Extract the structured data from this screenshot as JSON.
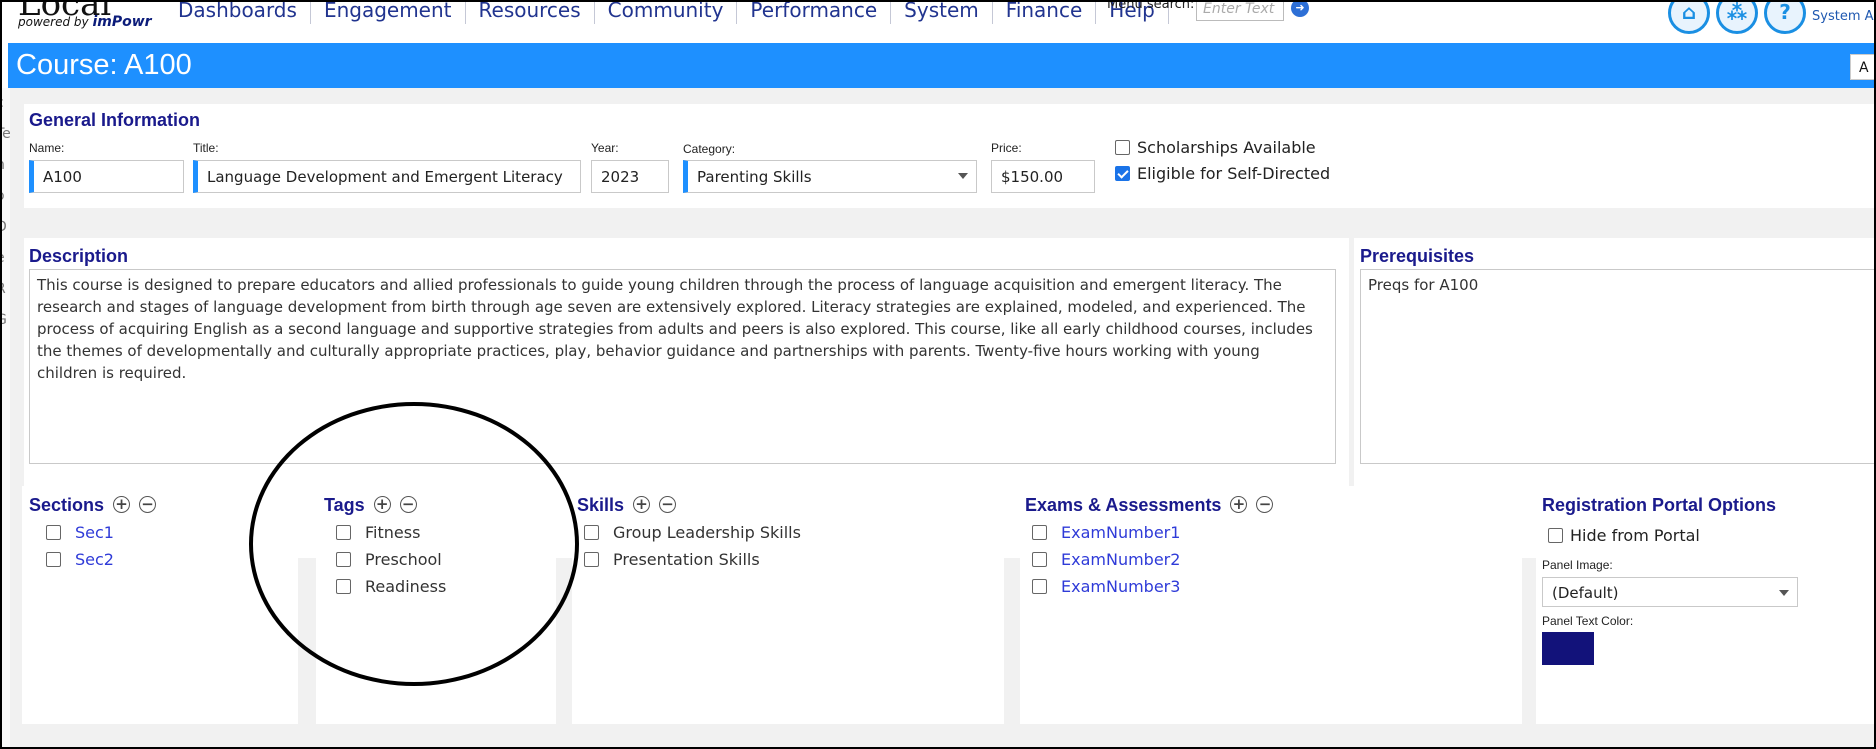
{
  "nav": {
    "logo_text": "Local",
    "logo_powered": "powered by",
    "logo_brand": "imPowr",
    "menu": [
      "Dashboards",
      "Engagement",
      "Resources",
      "Community",
      "Performance",
      "System",
      "Finance",
      "Help"
    ],
    "menu_search_label": "Menu search:",
    "menu_search_placeholder": "Enter Text",
    "user_label": "System Admin"
  },
  "page": {
    "title": "Course: A100",
    "corner_button": "A"
  },
  "general": {
    "title": "General Information",
    "name_label": "Name:",
    "name_value": "A100",
    "title_label": "Title:",
    "title_value": "Language Development and Emergent Literacy",
    "year_label": "Year:",
    "year_value": "2023",
    "category_label": "Category:",
    "category_value": "Parenting Skills",
    "price_label": "Price:",
    "price_value": "$150.00",
    "scholarships_label": "Scholarships Available",
    "scholarships_checked": false,
    "self_directed_label": "Eligible for Self-Directed",
    "self_directed_checked": true
  },
  "description": {
    "title": "Description",
    "lines": [
      "This course is designed to prepare educators and allied professionals to guide young children through the process of language acquisition and emergent literacy. The",
      "research and stages of language development from birth through age seven are extensively explored. Literacy strategies are explained, modeled, and experienced. The",
      "process of acquiring English as a second language and supportive strategies from adults and peers is also explored. This course, like all early childhood courses, includes",
      "the themes of developmentally and culturally appropriate practices, play, behavior guidance and partnerships with parents. Twenty-five hours working with young",
      "children is required."
    ]
  },
  "prerequisites": {
    "title": "Prerequisites",
    "text": "Preqs for A100"
  },
  "sections": {
    "title": "Sections",
    "items": [
      "Sec1",
      "Sec2"
    ]
  },
  "tags": {
    "title": "Tags",
    "items": [
      "Fitness",
      "Preschool",
      "Readiness"
    ]
  },
  "skills": {
    "title": "Skills",
    "items": [
      "Group Leadership Skills",
      "Presentation Skills"
    ]
  },
  "exams": {
    "title": "Exams & Assessments",
    "items": [
      "ExamNumber1",
      "ExamNumber2",
      "ExamNumber3"
    ]
  },
  "portal": {
    "title": "Registration Portal Options",
    "hide_label": "Hide from Portal",
    "panel_image_label": "Panel Image:",
    "panel_image_value": "(Default)",
    "panel_text_color_label": "Panel Text Color:",
    "panel_text_color": "#12127a"
  },
  "symbols": {
    "add": "⊕",
    "remove": "⊖"
  },
  "colors": {
    "accent": "#1e90ff",
    "heading": "#1a1a8c",
    "link": "#2f3bd8"
  },
  "icons": [
    "home-icon",
    "network-icon",
    "help-icon",
    "search-go-icon",
    "add-icon",
    "remove-icon"
  ]
}
